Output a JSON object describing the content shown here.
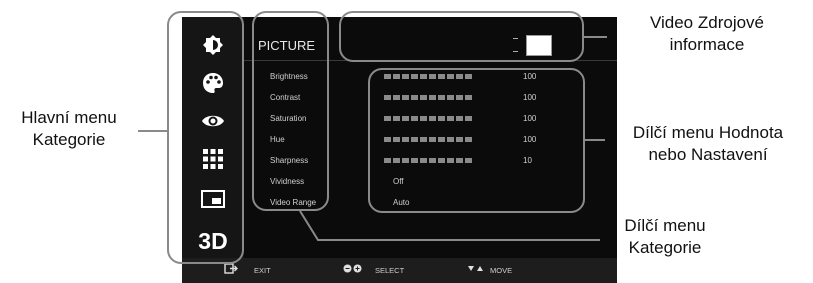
{
  "osd": {
    "title": "PICTURE",
    "categories": [
      {
        "icon": "brightness-icon"
      },
      {
        "icon": "palette-icon"
      },
      {
        "icon": "eye-icon"
      },
      {
        "icon": "grid-icon"
      },
      {
        "icon": "screen-icon"
      },
      {
        "icon": "3d-icon",
        "label": "3D"
      }
    ],
    "items": [
      {
        "label": "Brightness",
        "value": "100",
        "level": 1.0
      },
      {
        "label": "Contrast",
        "value": "100",
        "level": 1.0
      },
      {
        "label": "Saturation",
        "value": "100",
        "level": 1.0
      },
      {
        "label": "Hue",
        "value": "100",
        "level": 1.0
      },
      {
        "label": "Sharpness",
        "value": "10",
        "level": 1.0
      },
      {
        "label": "Vividness",
        "value": "Off"
      },
      {
        "label": "Video Range",
        "value": "Auto"
      }
    ],
    "footer": {
      "exit": "EXIT",
      "select": "SELECT",
      "move": "MOVE"
    }
  },
  "annotations": {
    "source_info": [
      "Video Zdrojové",
      "informace"
    ],
    "main_menu": [
      "Hlavní menu",
      "Kategorie"
    ],
    "value_menu": [
      "Dílčí menu Hodnota",
      "nebo Nastavení"
    ],
    "sub_category": [
      "Dílčí menu",
      "Kategorie"
    ]
  },
  "colors": {
    "osd_bg": "#0b0b0b",
    "bar": "#8a8a8a",
    "callout": "#8a8a8a"
  }
}
